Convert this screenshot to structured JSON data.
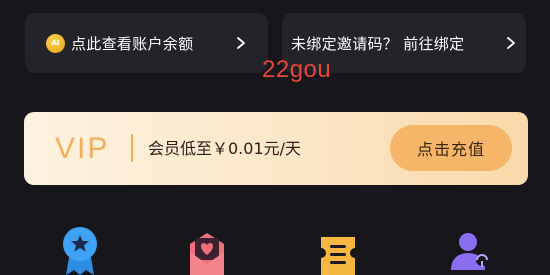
{
  "balance_card": {
    "coin_label": "AI",
    "text": "点此查看账户余额"
  },
  "invite_card": {
    "text": "未绑定邀请码？ 前往绑定"
  },
  "watermark": "22gou",
  "vip_banner": {
    "logo": "VIP",
    "text": "会员低至￥0.01元/天",
    "button_label": "点击充值"
  },
  "bottom_icons": [
    "star-badge-icon",
    "heart-envelope-icon",
    "ticket-icon",
    "user-group-icon"
  ],
  "colors": {
    "background": "#17161b",
    "card": "#242329",
    "vip_gold": "#f0b05a",
    "button": "#f5b669",
    "watermark": "#e8463a"
  }
}
